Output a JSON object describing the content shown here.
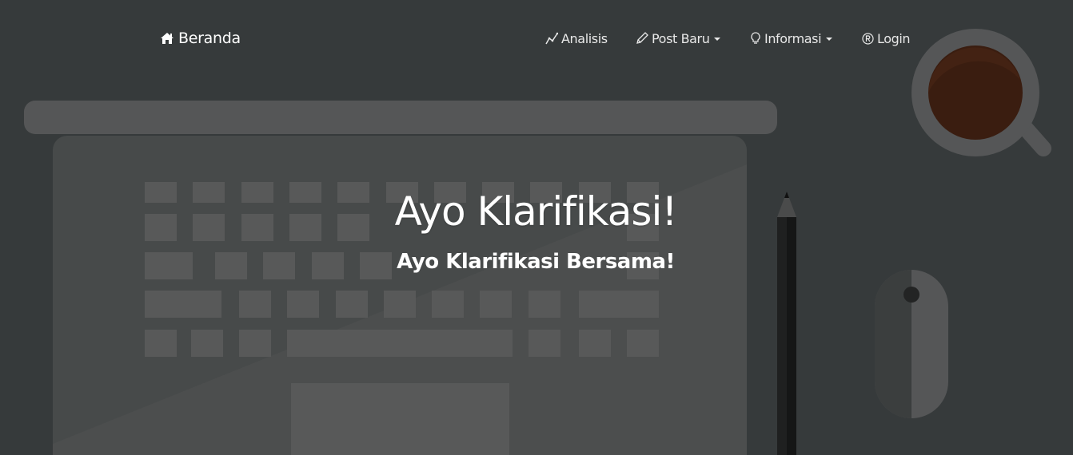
{
  "navbar": {
    "brand": {
      "label": "Beranda",
      "icon": "home-icon"
    },
    "items": [
      {
        "label": "Analisis",
        "icon": "chart-line-icon",
        "dropdown": false
      },
      {
        "label": "Post Baru",
        "icon": "pencil-icon",
        "dropdown": true
      },
      {
        "label": "Informasi",
        "icon": "lightbulb-icon",
        "dropdown": true
      },
      {
        "label": "Login",
        "icon": "registered-icon",
        "dropdown": false
      }
    ]
  },
  "hero": {
    "title": "Ayo Klarifikasi!",
    "subtitle": "Ayo Klarifikasi Bersama!"
  },
  "colors": {
    "background": "#363a3b",
    "text": "#ffffff",
    "coffee": "#3a1d10"
  }
}
